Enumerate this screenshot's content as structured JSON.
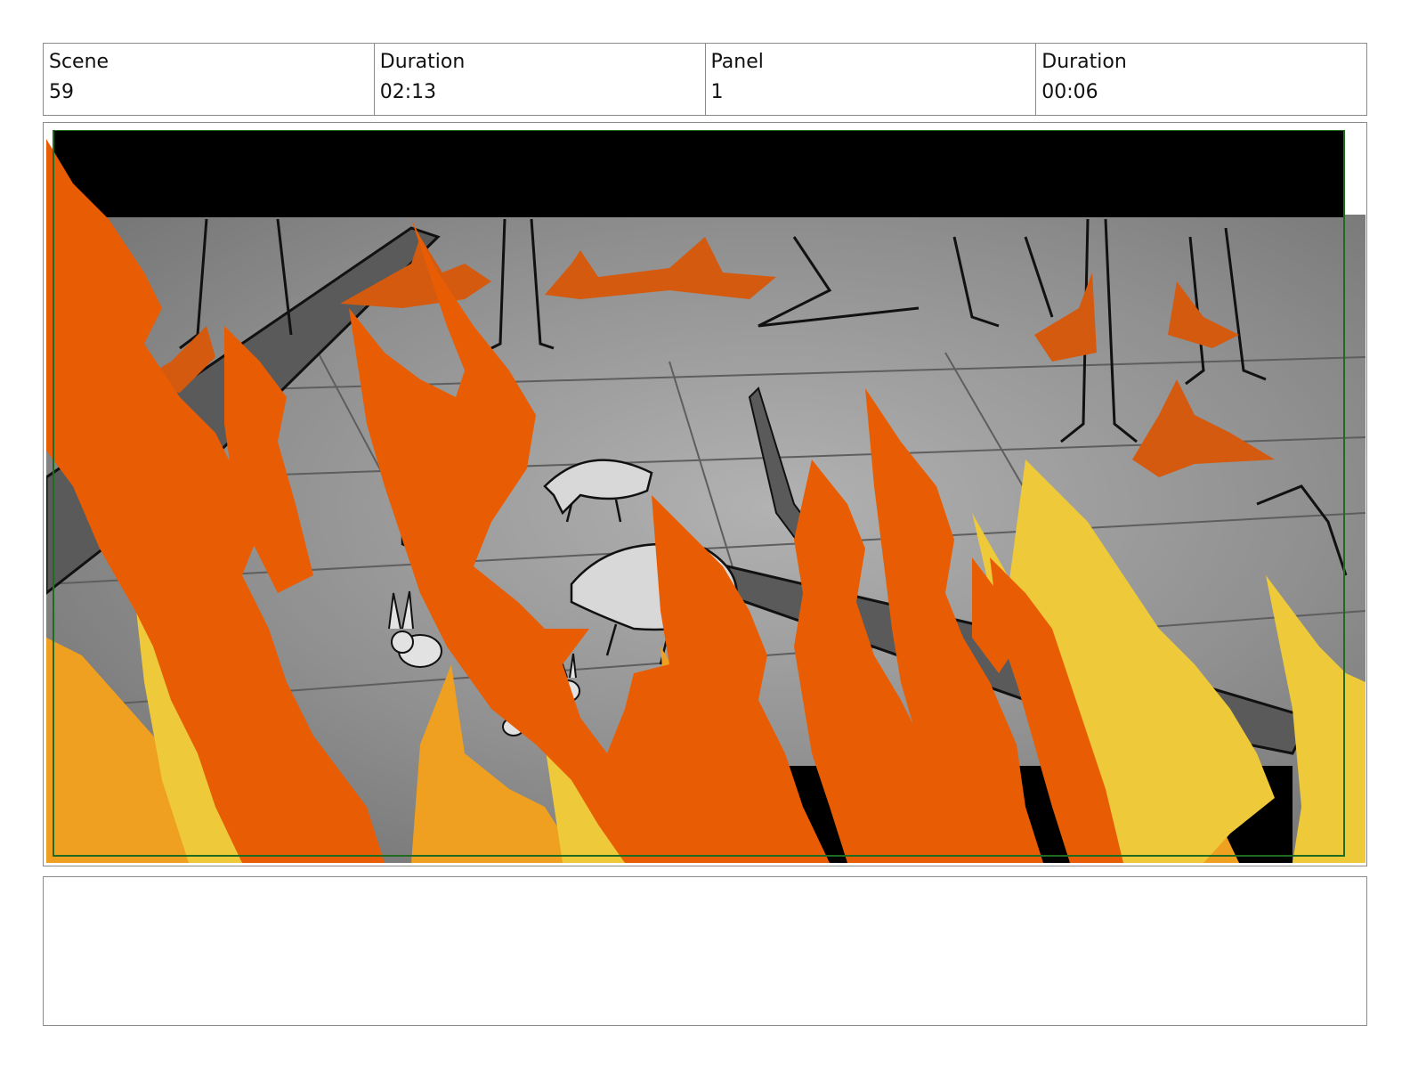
{
  "header": {
    "scene_label": "Scene",
    "scene_value": "59",
    "scene_duration_label": "Duration",
    "scene_duration_value": "02:13",
    "panel_label": "Panel",
    "panel_value": "1",
    "panel_duration_label": "Duration",
    "panel_duration_value": "00:06"
  },
  "panel_image": {
    "subject": "Animals (boars and rabbits) fleeing through a burning forest behind flames",
    "colors": {
      "flame_dark": "#e85d04",
      "flame_mid": "#efa020",
      "flame_light": "#eec93a",
      "ground": "#8e8e8e",
      "letterbox": "#000000",
      "frame_border": "#1f6b1f"
    }
  },
  "notes": {
    "text": ""
  }
}
